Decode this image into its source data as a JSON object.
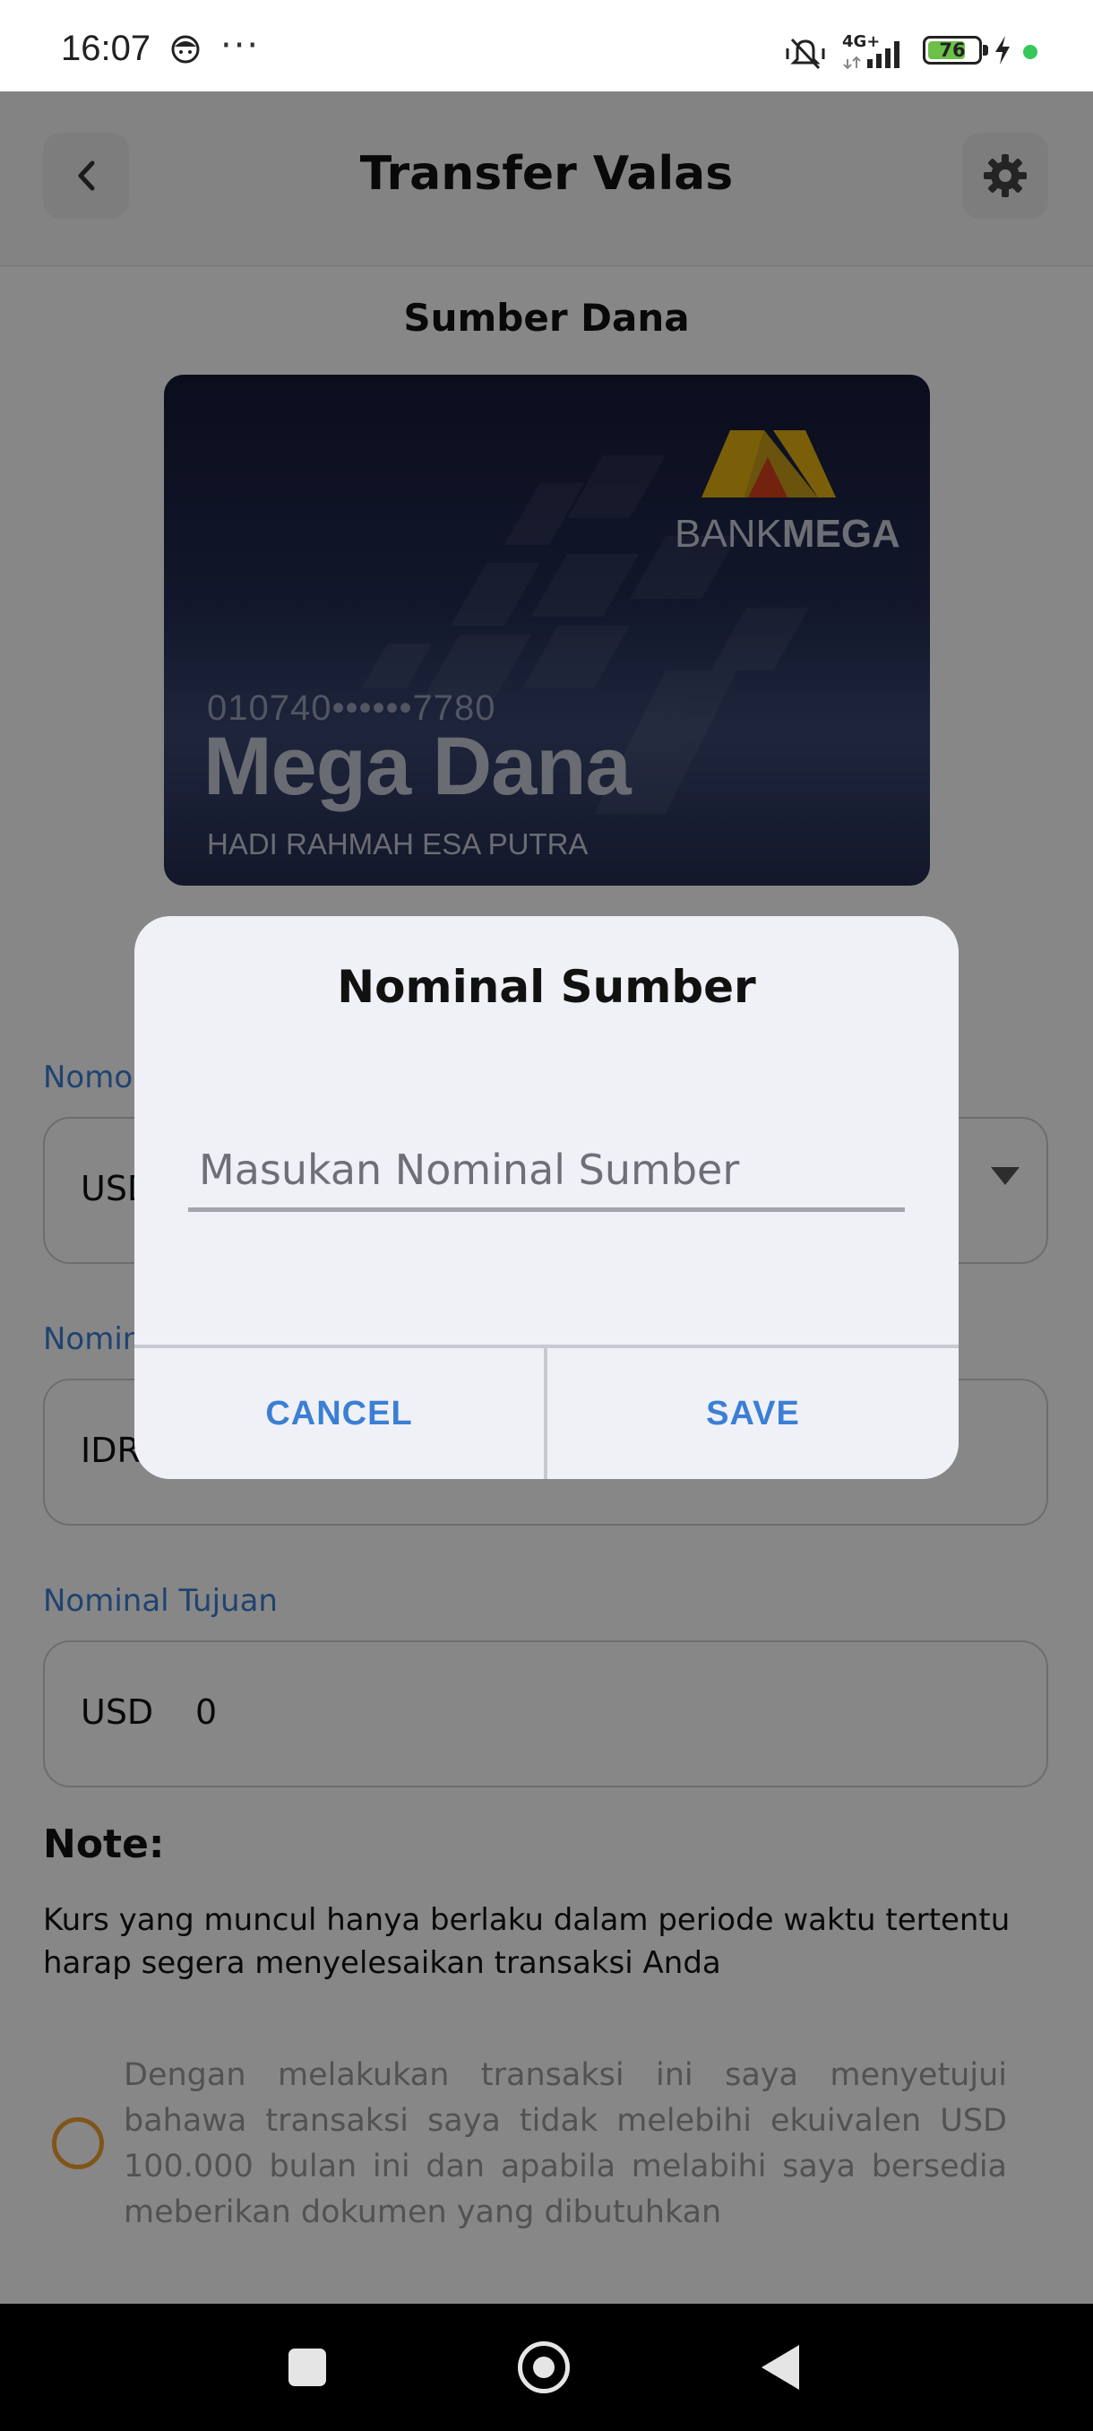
{
  "status_bar": {
    "time": "16:07",
    "more": "···",
    "network": "4G+",
    "battery_level": 76,
    "battery_text": "76",
    "icons": [
      "app-face-icon",
      "mute-vibrate-icon",
      "signal-icon",
      "battery-icon",
      "charging-icon",
      "active-dot"
    ]
  },
  "header": {
    "title": "Transfer Valas",
    "back_icon": "chevron-left-icon",
    "settings_icon": "gear-icon"
  },
  "source": {
    "title": "Sumber Dana",
    "card": {
      "bank_logo_text": "BANKMEGA",
      "number": "010740••••••7780",
      "product": "Mega Dana",
      "holder": "HADI RAHMAH ESA PUTRA"
    }
  },
  "form": {
    "account_field": {
      "label": "Nomor",
      "value": "USD"
    },
    "source_amount_field": {
      "label": "Nominal",
      "value": "IDR"
    },
    "target_amount_field": {
      "label": "Nominal Tujuan",
      "currency": "USD",
      "value": "0"
    }
  },
  "note": {
    "heading": "Note:",
    "text": "Kurs yang muncul hanya berlaku dalam periode waktu tertentu harap segera menyelesaikan transaksi Anda"
  },
  "consent": {
    "text": "Dengan melakukan transaksi ini saya menyetujui bahawa transaksi saya tidak melebihi ekuivalen USD 100.000 bulan ini dan apabila melabihi saya bersedia meberikan dokumen yang dibutuhkan",
    "checked": false
  },
  "dialog": {
    "title": "Nominal Sumber",
    "input_placeholder": "Masukan Nominal Sumber",
    "input_value": "",
    "cancel_label": "CANCEL",
    "save_label": "SAVE"
  },
  "colors": {
    "accent": "#3b7fd4",
    "radio_ring": "#f0a030",
    "card_dark": "#141a36",
    "logo_yellow": "#e8b410",
    "logo_red": "#d8401c"
  },
  "nav_bar": {
    "icons": [
      "recents-square-icon",
      "home-circle-icon",
      "back-triangle-icon"
    ]
  }
}
